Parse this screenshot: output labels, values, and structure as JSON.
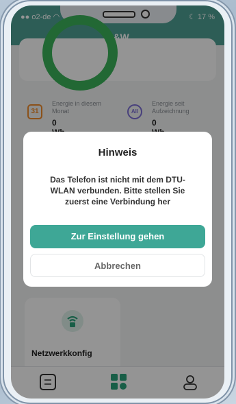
{
  "status_bar": {
    "carrier": "o2-de",
    "battery": "17 %"
  },
  "header": {
    "title": "B&W"
  },
  "stats": {
    "month_label": "Energie in diesem Monat",
    "month_value": "0 Wh",
    "month_icon_text": "31",
    "total_label": "Energie seit Aufzeichnung",
    "total_value": "0 Wh",
    "total_icon_text": "All"
  },
  "network_card": {
    "label": "Netzwerkkonfig"
  },
  "dialog": {
    "title": "Hinweis",
    "message": "Das Telefon ist nicht mit dem DTU-WLAN verbunden. Bitte stellen Sie zuerst eine Verbindung her",
    "primary_button": "Zur Einstellung gehen",
    "secondary_button": "Abbrechen"
  },
  "colors": {
    "accent": "#3ea796",
    "header": "#4fa195",
    "ring": "#3bb35a"
  }
}
